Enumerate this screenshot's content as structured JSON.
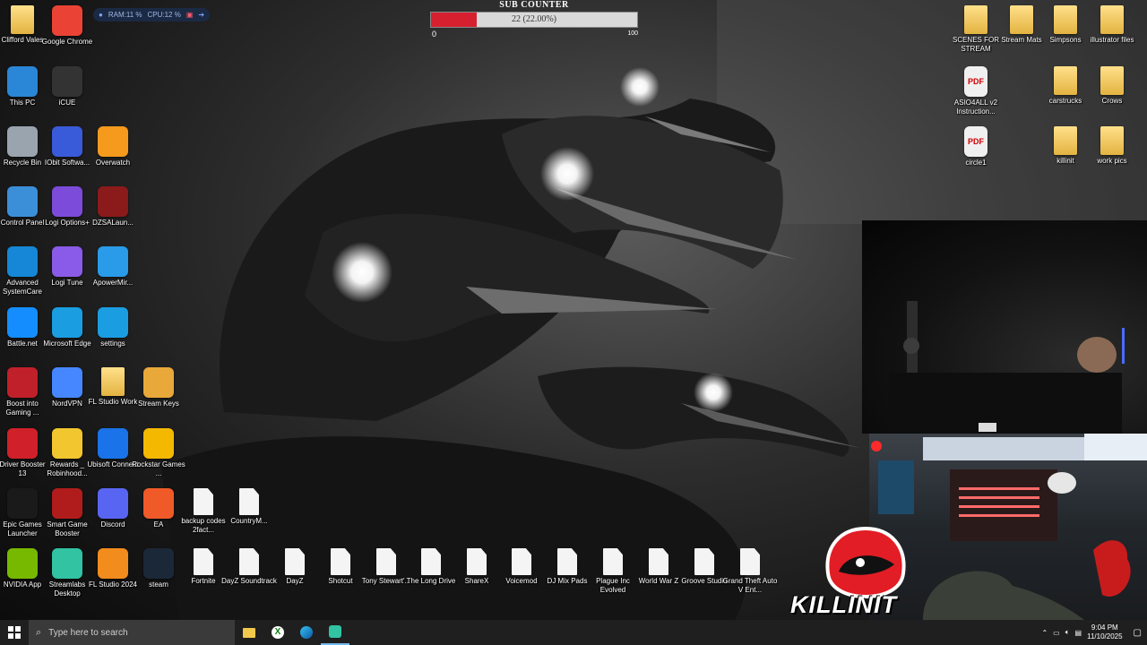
{
  "widgets": {
    "system_monitor": {
      "ram": "RAM:11 %",
      "cpu": "CPU:12 %"
    },
    "sub_counter": {
      "title": "SUB COUNTER",
      "value_text": "22 (22.00%)",
      "progress": 0.22,
      "min": "0",
      "max": "100",
      "fill_color": "#d62030"
    }
  },
  "desktop": {
    "left_icons": [
      {
        "label": "Clifford Vales",
        "icon": "user-folder-icon",
        "color": "#e3c26b"
      },
      {
        "label": "Google Chrome",
        "icon": "chrome-icon",
        "color": "#ea4335"
      },
      {
        "label": "This PC",
        "icon": "computer-icon",
        "color": "#2a86d6"
      },
      {
        "label": "iCUE",
        "icon": "icue-icon",
        "color": "#333333"
      },
      {
        "label": "Recycle Bin",
        "icon": "recycle-bin-icon",
        "color": "#9aa4ae"
      },
      {
        "label": "IObit Softwa...",
        "icon": "iobit-icon",
        "color": "#3a5bd9"
      },
      {
        "label": "Overwatch",
        "icon": "overwatch-icon",
        "color": "#f59a1d"
      },
      {
        "label": "Control Panel",
        "icon": "control-panel-icon",
        "color": "#3b8fd9"
      },
      {
        "label": "Logi Options+",
        "icon": "logi-options-icon",
        "color": "#7d4bd9"
      },
      {
        "label": "DZSALaun...",
        "icon": "dzsa-icon",
        "color": "#8b1a1a"
      },
      {
        "label": "Advanced SystemCare",
        "icon": "systemcare-icon",
        "color": "#1587d6"
      },
      {
        "label": "Logi Tune",
        "icon": "logi-tune-icon",
        "color": "#8a5be8"
      },
      {
        "label": "ApowerMir...",
        "icon": "apowermirror-icon",
        "color": "#2a9be8"
      },
      {
        "label": "Battle.net",
        "icon": "battlenet-icon",
        "color": "#148eff"
      },
      {
        "label": "Microsoft Edge",
        "icon": "edge-icon",
        "color": "#1b9de2"
      },
      {
        "label": "settings",
        "icon": "settings-edge-icon",
        "color": "#1b9de2"
      },
      {
        "label": "Boost into Gaming ...",
        "icon": "boost-icon",
        "color": "#c0202a"
      },
      {
        "label": "NordVPN",
        "icon": "nordvpn-icon",
        "color": "#4687ff"
      },
      {
        "label": "FL Studio Work",
        "icon": "fl-folder-icon",
        "color": "#e3c26b"
      },
      {
        "label": "Stream Keys",
        "icon": "stream-keys-icon",
        "color": "#e8a93a"
      },
      {
        "label": "Driver Booster 13",
        "icon": "driver-booster-icon",
        "color": "#d0202a"
      },
      {
        "label": "Rewards _ Robinhood...",
        "icon": "star-icon",
        "color": "#f2c62e"
      },
      {
        "label": "Ubisoft Connect",
        "icon": "ubisoft-icon",
        "color": "#1a73e8"
      },
      {
        "label": "Rockstar Games ...",
        "icon": "rockstar-icon",
        "color": "#f5b800"
      },
      {
        "label": "Epic Games Launcher",
        "icon": "epic-games-icon",
        "color": "#1a1a1a"
      },
      {
        "label": "Smart Game Booster",
        "icon": "game-booster-icon",
        "color": "#b01c1c"
      },
      {
        "label": "Discord",
        "icon": "discord-icon",
        "color": "#5865f2"
      },
      {
        "label": "EA",
        "icon": "ea-icon",
        "color": "#f05a28"
      },
      {
        "label": "backup codes 2fact...",
        "icon": "document-icon",
        "color": "#f4f4f4"
      },
      {
        "label": "CountryM...",
        "icon": "document-icon",
        "color": "#f4f4f4"
      },
      {
        "label": "NVIDIA App",
        "icon": "nvidia-icon",
        "color": "#76b900"
      },
      {
        "label": "Streamlabs Desktop",
        "icon": "streamlabs-icon",
        "color": "#31c3a2"
      },
      {
        "label": "FL Studio 2024",
        "icon": "fl-studio-icon",
        "color": "#f28c1c"
      },
      {
        "label": "steam",
        "icon": "steam-icon",
        "color": "#1b2838"
      },
      {
        "label": "Fortnite",
        "icon": "document-icon",
        "color": "#f4f4f4"
      },
      {
        "label": "DayZ Soundtrack",
        "icon": "document-icon",
        "color": "#f4f4f4"
      },
      {
        "label": "DayZ",
        "icon": "document-icon",
        "color": "#f4f4f4"
      },
      {
        "label": "Shotcut",
        "icon": "document-icon",
        "color": "#f4f4f4"
      },
      {
        "label": "Tony Stewart'...",
        "icon": "document-icon",
        "color": "#f4f4f4"
      },
      {
        "label": "The Long Drive",
        "icon": "document-icon",
        "color": "#f4f4f4"
      },
      {
        "label": "ShareX",
        "icon": "document-icon",
        "color": "#f4f4f4"
      },
      {
        "label": "Voicemod",
        "icon": "document-icon",
        "color": "#f4f4f4"
      },
      {
        "label": "DJ Mix Pads",
        "icon": "document-icon",
        "color": "#f4f4f4"
      },
      {
        "label": "Plague Inc Evolved",
        "icon": "document-icon",
        "color": "#f4f4f4"
      },
      {
        "label": "World War Z",
        "icon": "document-icon",
        "color": "#f4f4f4"
      },
      {
        "label": "Groove Studio",
        "icon": "document-icon",
        "color": "#f4f4f4"
      },
      {
        "label": "Grand Theft Auto V Ent...",
        "icon": "document-icon",
        "color": "#f4f4f4"
      }
    ],
    "right_icons": [
      {
        "label": "SCENES FOR STREAM",
        "icon": "scenes-folder-icon",
        "color": "#e3c26b"
      },
      {
        "label": "Stream Mats",
        "icon": "folder-icon",
        "color": "#e3c26b"
      },
      {
        "label": "Simpsons",
        "icon": "folder-icon",
        "color": "#e3c26b"
      },
      {
        "label": "illustrator files",
        "icon": "folder-icon",
        "color": "#e3c26b"
      },
      {
        "label": "ASIO4ALL v2 Instruction...",
        "icon": "pdf-icon",
        "color": "#d00000"
      },
      {
        "label": "carstrucks",
        "icon": "folder-icon",
        "color": "#e3c26b"
      },
      {
        "label": "Crows",
        "icon": "folder-icon",
        "color": "#e3c26b"
      },
      {
        "label": "circle1",
        "icon": "pdf-icon",
        "color": "#d00000"
      },
      {
        "label": "killinit",
        "icon": "folder-icon",
        "color": "#e3c26b"
      },
      {
        "label": "work pics",
        "icon": "folder-icon",
        "color": "#e3c26b"
      }
    ]
  },
  "overlay": {
    "brand": "KILLINIT"
  },
  "taskbar": {
    "search_placeholder": "Type here to search",
    "apps": [
      "file-explorer-icon",
      "xbox-icon",
      "edge-icon",
      "streamlabs-icon"
    ],
    "time": "9:04 PM",
    "date": "11/10/2025"
  }
}
